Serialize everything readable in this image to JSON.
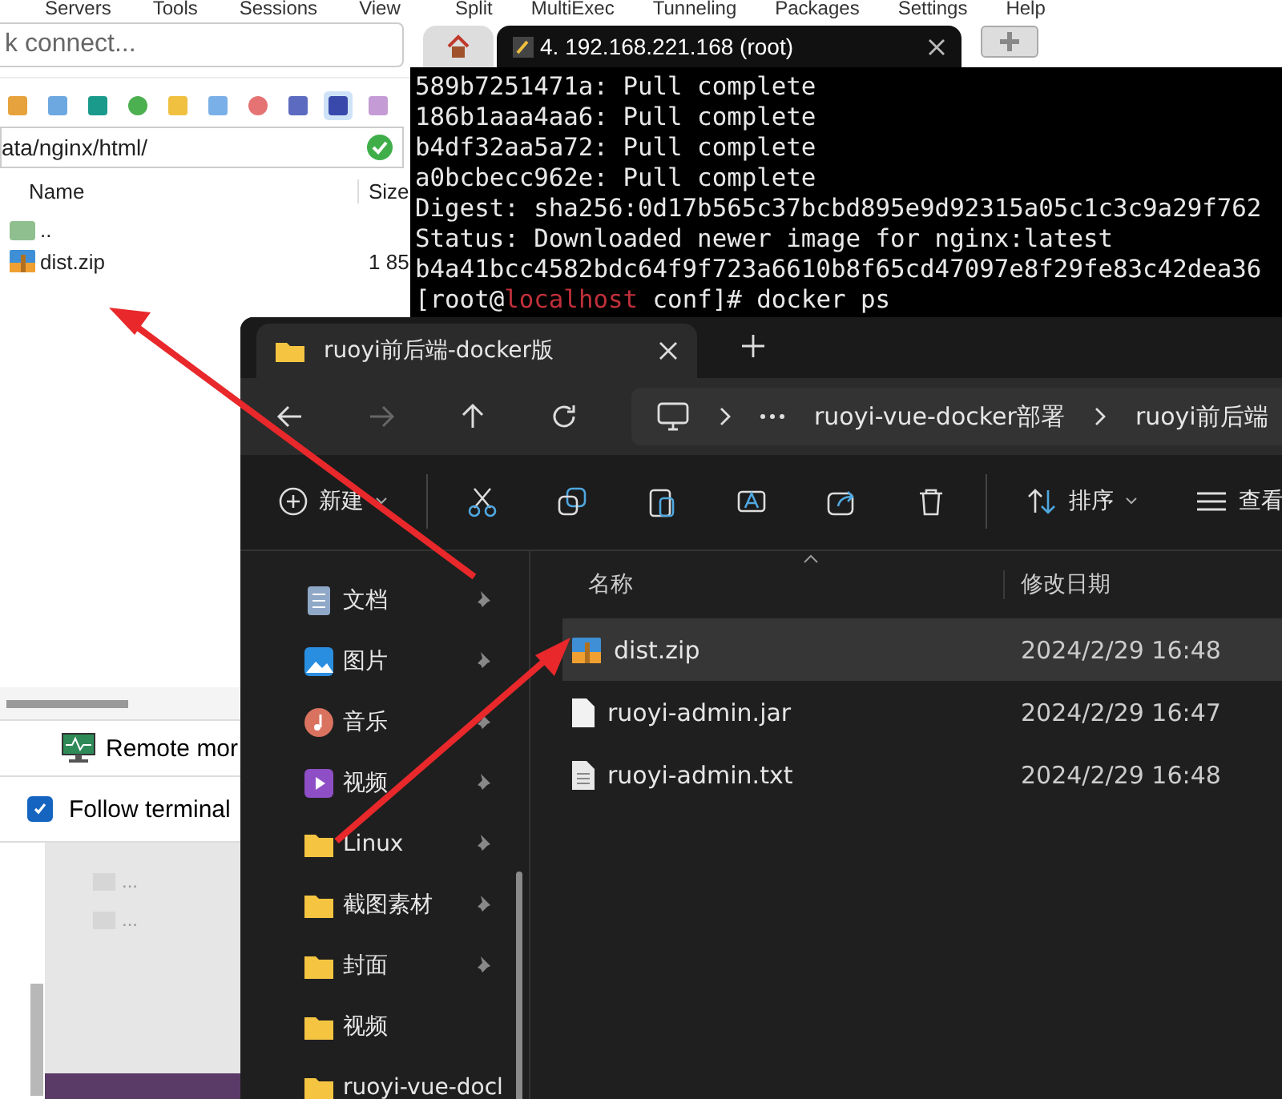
{
  "left_panel": {
    "menu": [
      "Servers",
      "Tools",
      "Sessions",
      "View"
    ],
    "quick_connect": {
      "placeholder": "k connect..."
    },
    "path": "ata/nginx/html/",
    "columns": [
      "Name",
      "Size"
    ],
    "files": [
      {
        "kind": "parent",
        "name": ".."
      },
      {
        "kind": "zip",
        "name": "dist.zip",
        "size": "1 85"
      }
    ],
    "remote_monitoring": "Remote mor",
    "follow_terminal": {
      "label": "Follow terminal",
      "checked": true
    },
    "list_items": [
      "...",
      "..."
    ]
  },
  "terminal": {
    "menu": [
      "Split",
      "MultiExec",
      "Tunneling",
      "Packages",
      "Settings",
      "Help"
    ],
    "tabs": [
      {
        "kind": "home",
        "selected": false
      },
      {
        "kind": "session",
        "label": "4. 192.168.221.168 (root)",
        "selected": true
      }
    ],
    "lines": [
      "589b7251471a: Pull complete",
      "186b1aaa4aa6: Pull complete",
      "b4df32aa5a72: Pull complete",
      "a0bcbecc962e: Pull complete",
      "Digest: sha256:0d17b565c37bcbd895e9d92315a05c1c3c9a29f762",
      "Status: Downloaded newer image for nginx:latest",
      "b4a41bcc4582bdc64f9f723a6610b8f65cd47097e8f29fe83c42dea36"
    ],
    "prompt": {
      "user": "[root@",
      "host": "localhost",
      "rest": " conf]# docker ps"
    }
  },
  "explorer": {
    "tab_title": "ruoyi前后端-docker版",
    "breadcrumb": [
      "ruoyi-vue-docker部署",
      "ruoyi前后端"
    ],
    "new_label": "新建",
    "sort_label": "排序",
    "view_label": "查看",
    "columns": [
      "名称",
      "修改日期"
    ],
    "sidebar": [
      {
        "kind": "docs",
        "label": "文档",
        "pinned": true
      },
      {
        "kind": "pictures",
        "label": "图片",
        "pinned": true
      },
      {
        "kind": "music",
        "label": "音乐",
        "pinned": true
      },
      {
        "kind": "video",
        "label": "视频",
        "pinned": true
      },
      {
        "kind": "folder",
        "label": "Linux",
        "pinned": true
      },
      {
        "kind": "folder",
        "label": "截图素材",
        "pinned": true
      },
      {
        "kind": "folder",
        "label": "封面",
        "pinned": true
      },
      {
        "kind": "folder",
        "label": "视频",
        "pinned": false
      },
      {
        "kind": "folder",
        "label": "ruoyi-vue-docl",
        "pinned": false
      }
    ],
    "files": [
      {
        "kind": "zip",
        "name": "dist.zip",
        "date": "2024/2/29 16:48",
        "selected": true
      },
      {
        "kind": "file",
        "name": "ruoyi-admin.jar",
        "date": "2024/2/29 16:47",
        "selected": false
      },
      {
        "kind": "text",
        "name": "ruoyi-admin.txt",
        "date": "2024/2/29 16:48",
        "selected": false
      }
    ]
  }
}
